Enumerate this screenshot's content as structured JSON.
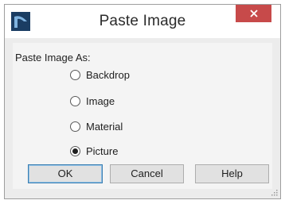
{
  "window": {
    "title": "Paste Image",
    "close_icon": "close-icon",
    "app_icon": "app-logo-icon"
  },
  "dialog": {
    "group_label": "Paste Image As:",
    "options": [
      {
        "label": "Backdrop",
        "checked": false
      },
      {
        "label": "Image",
        "checked": false
      },
      {
        "label": "Material",
        "checked": false
      },
      {
        "label": "Picture",
        "checked": true
      }
    ],
    "buttons": {
      "ok": "OK",
      "cancel": "Cancel",
      "help": "Help"
    }
  },
  "colors": {
    "close_button": "#c74a4a",
    "app_icon": "#1a3d63",
    "default_button_border": "#3c7fb1"
  }
}
